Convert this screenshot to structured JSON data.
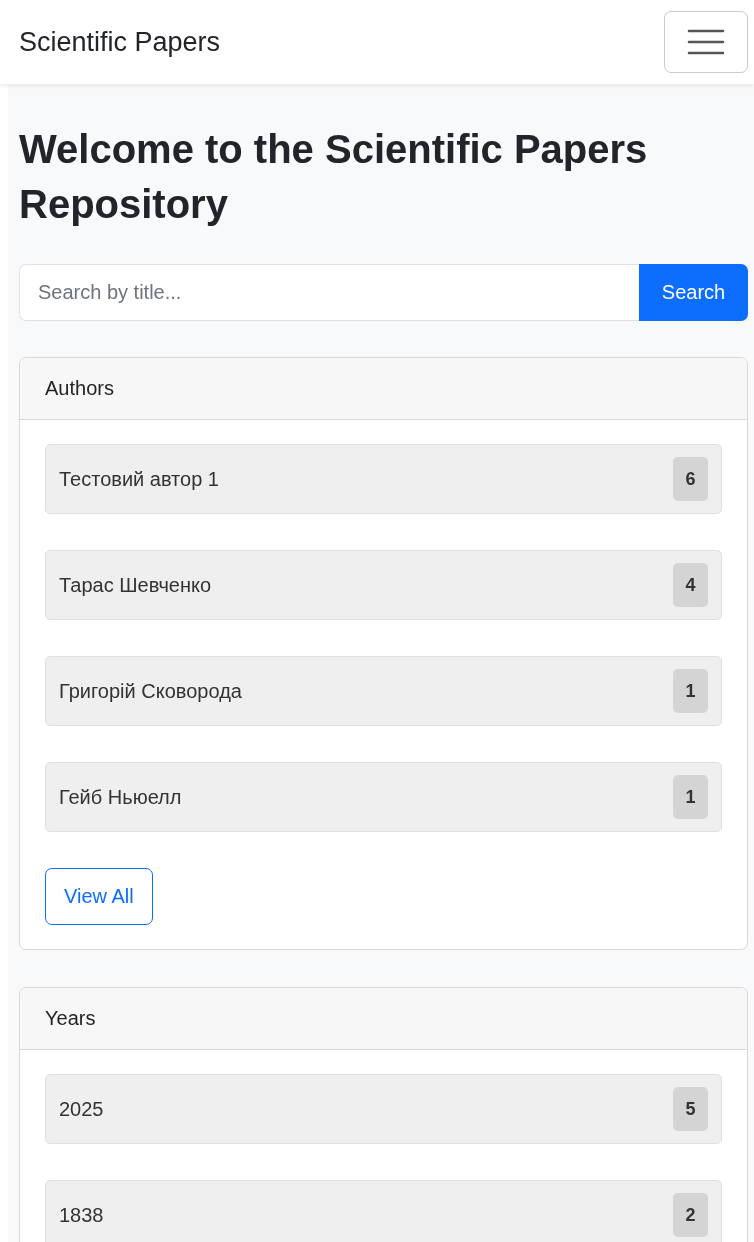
{
  "navbar": {
    "brand": "Scientific Papers"
  },
  "heading": "Welcome to the Scientific Papers Repository",
  "search": {
    "placeholder": "Search by title...",
    "button": "Search"
  },
  "cards": [
    {
      "title": "Authors",
      "items": [
        {
          "label": "Тестовий автор 1",
          "count": "6"
        },
        {
          "label": "Тарас Шевченко",
          "count": "4"
        },
        {
          "label": "Григорій Сковорода",
          "count": "1"
        },
        {
          "label": "Гейб Ньюелл",
          "count": "1"
        }
      ],
      "button": "View All"
    },
    {
      "title": "Years",
      "items": [
        {
          "label": "2025",
          "count": "5"
        },
        {
          "label": "1838",
          "count": "2"
        }
      ]
    }
  ]
}
